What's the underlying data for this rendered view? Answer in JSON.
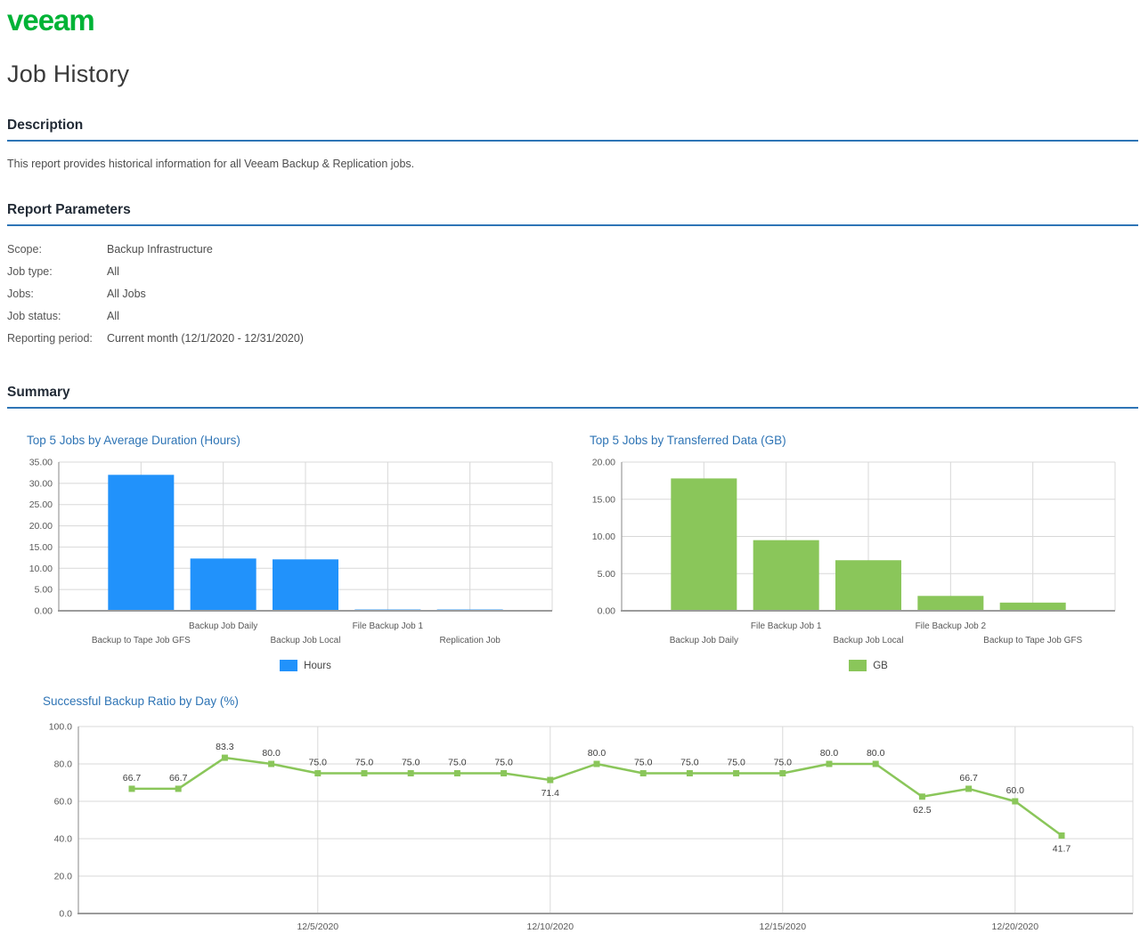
{
  "brand": {
    "logo_text": "veeam",
    "logo_color": "#00B336"
  },
  "title": "Job History",
  "sections": {
    "description": {
      "heading": "Description",
      "text": "This report provides historical information for all Veeam Backup & Replication jobs."
    },
    "parameters": {
      "heading": "Report Parameters",
      "rows": [
        {
          "label": "Scope:",
          "value": "Backup Infrastructure"
        },
        {
          "label": "Job type:",
          "value": "All"
        },
        {
          "label": "Jobs:",
          "value": "All Jobs"
        },
        {
          "label": "Job status:",
          "value": "All"
        },
        {
          "label": "Reporting period:",
          "value": "Current month (12/1/2020 - 12/31/2020)"
        }
      ]
    },
    "summary": {
      "heading": "Summary"
    }
  },
  "colors": {
    "bar_blue": "#2192FB",
    "bar_green": "#8AC65A",
    "heading_rule": "#2E75B6",
    "chart_title": "#2E74B5",
    "gridline": "#D8D8D8",
    "axis": "#9B9B9B",
    "tick_text": "#595959"
  },
  "chart_data": [
    {
      "type": "bar",
      "title": "Top 5 Jobs by Average Duration (Hours)",
      "categories": [
        "Backup to Tape Job GFS",
        "Backup Job Daily",
        "Backup Job Local",
        "File Backup Job 1",
        "Replication Job"
      ],
      "values": [
        32.0,
        12.3,
        12.1,
        0.3,
        0.3
      ],
      "legend": "Hours",
      "color": "#2192FB",
      "ylim": [
        0,
        35
      ],
      "y_tick_step": 5,
      "y_tick_decimals": 2,
      "grid": true,
      "legend_position": "bottom"
    },
    {
      "type": "bar",
      "title": "Top 5 Jobs by Transferred Data (GB)",
      "categories": [
        "Backup Job Daily",
        "File Backup Job 1",
        "Backup Job Local",
        "File Backup Job 2",
        "Backup to Tape Job GFS"
      ],
      "values": [
        17.8,
        9.5,
        6.8,
        2.0,
        1.1
      ],
      "legend": "GB",
      "color": "#8AC65A",
      "ylim": [
        0,
        20
      ],
      "y_tick_step": 5,
      "y_tick_decimals": 2,
      "grid": true,
      "legend_position": "bottom"
    },
    {
      "type": "line",
      "title": "Successful Backup Ratio by Day (%)",
      "x": [
        "12/1/2020",
        "12/2/2020",
        "12/3/2020",
        "12/4/2020",
        "12/5/2020",
        "12/6/2020",
        "12/7/2020",
        "12/8/2020",
        "12/9/2020",
        "12/10/2020",
        "12/11/2020",
        "12/12/2020",
        "12/13/2020",
        "12/14/2020",
        "12/15/2020",
        "12/16/2020",
        "12/17/2020",
        "12/18/2020",
        "12/19/2020",
        "12/20/2020",
        "12/21/2020"
      ],
      "values": [
        66.7,
        66.7,
        83.3,
        80.0,
        75.0,
        75.0,
        75.0,
        75.0,
        75.0,
        71.4,
        80.0,
        75.0,
        75.0,
        75.0,
        75.0,
        80.0,
        80.0,
        62.5,
        66.7,
        60.0,
        41.7
      ],
      "x_axis_labels": [
        {
          "index": 4,
          "label": "12/5/2020"
        },
        {
          "index": 9,
          "label": "12/10/2020"
        },
        {
          "index": 14,
          "label": "12/15/2020"
        },
        {
          "index": 19,
          "label": "12/20/2020"
        }
      ],
      "label_below_indices": [
        9,
        17,
        20
      ],
      "color": "#8AC65A",
      "ylim": [
        0,
        100
      ],
      "y_tick_step": 20,
      "y_tick_decimals": 1,
      "grid": true,
      "legend_position": "none"
    }
  ]
}
